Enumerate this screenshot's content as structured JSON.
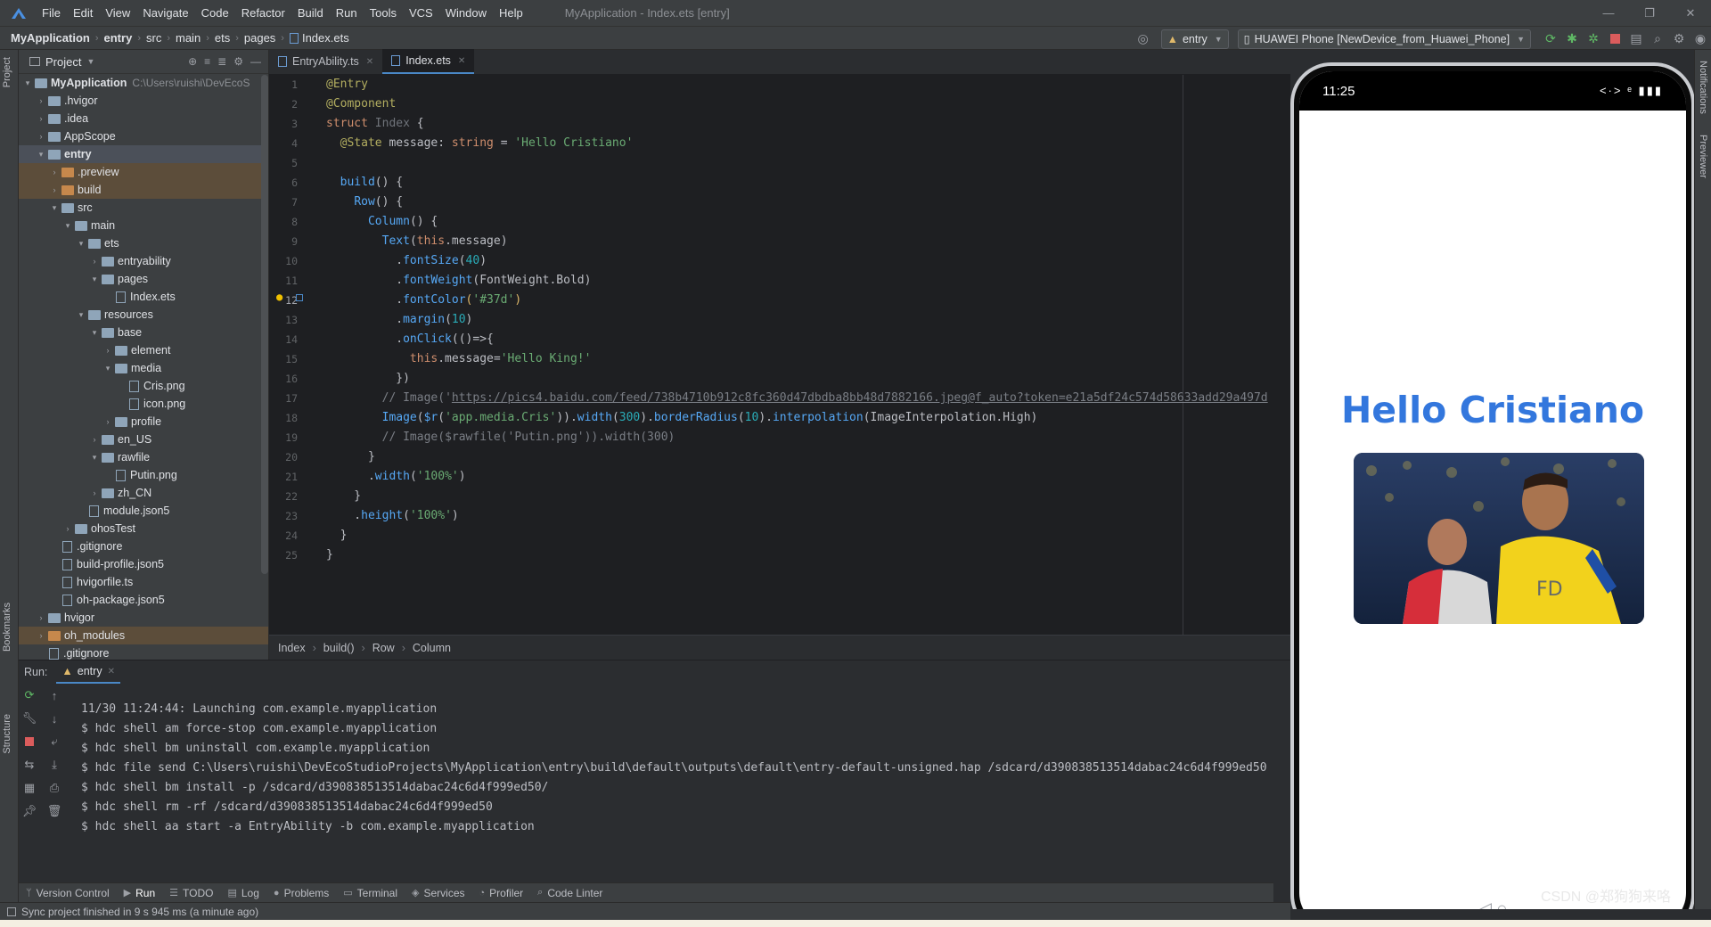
{
  "window": {
    "title": "MyApplication - Index.ets [entry]",
    "menu": [
      "File",
      "Edit",
      "View",
      "Navigate",
      "Code",
      "Refactor",
      "Build",
      "Run",
      "Tools",
      "VCS",
      "Window",
      "Help"
    ]
  },
  "breadcrumbs": [
    "MyApplication",
    "entry",
    "src",
    "main",
    "ets",
    "pages",
    "Index.ets"
  ],
  "run_config": {
    "module": "entry",
    "device": "HUAWEI Phone [NewDevice_from_Huawei_Phone]"
  },
  "project_panel": {
    "title": "Project",
    "tree": [
      {
        "label": "MyApplication",
        "path": "C:\\Users\\ruishi\\DevEcoS",
        "depth": 0,
        "type": "folder",
        "open": true,
        "bold": true
      },
      {
        "label": ".hvigor",
        "depth": 1,
        "type": "folder",
        "open": false
      },
      {
        "label": ".idea",
        "depth": 1,
        "type": "folder",
        "open": false
      },
      {
        "label": "AppScope",
        "depth": 1,
        "type": "folder",
        "open": false
      },
      {
        "label": "entry",
        "depth": 1,
        "type": "folder",
        "open": true,
        "bold": true,
        "highlight": "sel"
      },
      {
        "label": ".preview",
        "depth": 2,
        "type": "folder",
        "open": false,
        "color": "orange",
        "highlight": "hl"
      },
      {
        "label": "build",
        "depth": 2,
        "type": "folder",
        "open": false,
        "color": "orange",
        "highlight": "hl"
      },
      {
        "label": "src",
        "depth": 2,
        "type": "folder",
        "open": true
      },
      {
        "label": "main",
        "depth": 3,
        "type": "folder",
        "open": true
      },
      {
        "label": "ets",
        "depth": 4,
        "type": "folder",
        "open": true
      },
      {
        "label": "entryability",
        "depth": 5,
        "type": "folder",
        "open": false
      },
      {
        "label": "pages",
        "depth": 5,
        "type": "folder",
        "open": true
      },
      {
        "label": "Index.ets",
        "depth": 6,
        "type": "file"
      },
      {
        "label": "resources",
        "depth": 4,
        "type": "folder",
        "open": true
      },
      {
        "label": "base",
        "depth": 5,
        "type": "folder",
        "open": true
      },
      {
        "label": "element",
        "depth": 6,
        "type": "folder",
        "open": false
      },
      {
        "label": "media",
        "depth": 6,
        "type": "folder",
        "open": true
      },
      {
        "label": "Cris.png",
        "depth": 7,
        "type": "file"
      },
      {
        "label": "icon.png",
        "depth": 7,
        "type": "file"
      },
      {
        "label": "profile",
        "depth": 6,
        "type": "folder",
        "open": false
      },
      {
        "label": "en_US",
        "depth": 5,
        "type": "folder",
        "open": false
      },
      {
        "label": "rawfile",
        "depth": 5,
        "type": "folder",
        "open": true
      },
      {
        "label": "Putin.png",
        "depth": 6,
        "type": "file"
      },
      {
        "label": "zh_CN",
        "depth": 5,
        "type": "folder",
        "open": false
      },
      {
        "label": "module.json5",
        "depth": 4,
        "type": "file"
      },
      {
        "label": "ohosTest",
        "depth": 3,
        "type": "folder",
        "open": false
      },
      {
        "label": ".gitignore",
        "depth": 2,
        "type": "file"
      },
      {
        "label": "build-profile.json5",
        "depth": 2,
        "type": "file"
      },
      {
        "label": "hvigorfile.ts",
        "depth": 2,
        "type": "file"
      },
      {
        "label": "oh-package.json5",
        "depth": 2,
        "type": "file"
      },
      {
        "label": "hvigor",
        "depth": 1,
        "type": "folder",
        "open": false
      },
      {
        "label": "oh_modules",
        "depth": 1,
        "type": "folder",
        "open": false,
        "color": "orange",
        "highlight": "hl"
      },
      {
        "label": ".gitignore",
        "depth": 1,
        "type": "file"
      }
    ]
  },
  "editor": {
    "tabs": [
      {
        "label": "EntryAbility.ts",
        "active": false
      },
      {
        "label": "Index.ets",
        "active": true
      }
    ],
    "current_line": 12,
    "lines": [
      [
        {
          "c": "dec",
          "t": "@Entry"
        }
      ],
      [
        {
          "c": "dec",
          "t": "@Component"
        }
      ],
      [
        {
          "c": "kw",
          "t": "struct "
        },
        {
          "c": "cls",
          "t": "Index"
        },
        {
          "c": "",
          "t": " {"
        }
      ],
      [
        {
          "c": "",
          "t": "  "
        },
        {
          "c": "dec",
          "t": "@State"
        },
        {
          "c": "",
          "t": " message: "
        },
        {
          "c": "kw",
          "t": "string"
        },
        {
          "c": "",
          "t": " = "
        },
        {
          "c": "str",
          "t": "'Hello Cristiano'"
        }
      ],
      [
        {
          "c": "",
          "t": ""
        }
      ],
      [
        {
          "c": "",
          "t": "  "
        },
        {
          "c": "fn",
          "t": "build"
        },
        {
          "c": "",
          "t": "() {"
        }
      ],
      [
        {
          "c": "",
          "t": "    "
        },
        {
          "c": "fn",
          "t": "Row"
        },
        {
          "c": "",
          "t": "() {"
        }
      ],
      [
        {
          "c": "",
          "t": "      "
        },
        {
          "c": "fn",
          "t": "Column"
        },
        {
          "c": "",
          "t": "() {"
        }
      ],
      [
        {
          "c": "",
          "t": "        "
        },
        {
          "c": "fn",
          "t": "Text"
        },
        {
          "c": "",
          "t": "("
        },
        {
          "c": "kw",
          "t": "this"
        },
        {
          "c": "",
          "t": ".message)"
        }
      ],
      [
        {
          "c": "",
          "t": "          ."
        },
        {
          "c": "fn",
          "t": "fontSize"
        },
        {
          "c": "",
          "t": "("
        },
        {
          "c": "num",
          "t": "40"
        },
        {
          "c": "",
          "t": ")"
        }
      ],
      [
        {
          "c": "",
          "t": "          ."
        },
        {
          "c": "fn",
          "t": "fontWeight"
        },
        {
          "c": "",
          "t": "(FontWeight.Bold)"
        }
      ],
      [
        {
          "c": "",
          "t": "          ."
        },
        {
          "c": "fn",
          "t": "fontColor"
        },
        {
          "c": "yel",
          "t": "("
        },
        {
          "c": "str",
          "t": "'#37d'"
        },
        {
          "c": "yel",
          "t": ")"
        }
      ],
      [
        {
          "c": "",
          "t": "          ."
        },
        {
          "c": "fn",
          "t": "margin"
        },
        {
          "c": "",
          "t": "("
        },
        {
          "c": "num",
          "t": "10"
        },
        {
          "c": "",
          "t": ")"
        }
      ],
      [
        {
          "c": "",
          "t": "          ."
        },
        {
          "c": "fn",
          "t": "onClick"
        },
        {
          "c": "",
          "t": "(()=>{"
        }
      ],
      [
        {
          "c": "",
          "t": "            "
        },
        {
          "c": "kw",
          "t": "this"
        },
        {
          "c": "",
          "t": ".message="
        },
        {
          "c": "str",
          "t": "'Hello King!'"
        }
      ],
      [
        {
          "c": "",
          "t": "          })"
        }
      ],
      [
        {
          "c": "",
          "t": "        "
        },
        {
          "c": "cm",
          "t": "// Image('"
        },
        {
          "c": "lnk",
          "t": "https://pics4.baidu.com/feed/738b4710b912c8fc360d47dbdba8bb48d7882166.jpeg@f_auto?token=e21a5df24c574d58633add29a497d"
        }
      ],
      [
        {
          "c": "",
          "t": "        "
        },
        {
          "c": "fn",
          "t": "Image"
        },
        {
          "c": "",
          "t": "("
        },
        {
          "c": "fn",
          "t": "$r"
        },
        {
          "c": "",
          "t": "("
        },
        {
          "c": "str",
          "t": "'app.media.Cris'"
        },
        {
          "c": "",
          "t": "))."
        },
        {
          "c": "fn",
          "t": "width"
        },
        {
          "c": "",
          "t": "("
        },
        {
          "c": "num",
          "t": "300"
        },
        {
          "c": "",
          "t": ")."
        },
        {
          "c": "fn",
          "t": "borderRadius"
        },
        {
          "c": "",
          "t": "("
        },
        {
          "c": "num",
          "t": "10"
        },
        {
          "c": "",
          "t": ")."
        },
        {
          "c": "fn",
          "t": "interpolation"
        },
        {
          "c": "",
          "t": "(ImageInterpolation.High)"
        }
      ],
      [
        {
          "c": "",
          "t": "        "
        },
        {
          "c": "cm",
          "t": "// Image($rawfile('Putin.png')).width(300)"
        }
      ],
      [
        {
          "c": "",
          "t": "      }"
        }
      ],
      [
        {
          "c": "",
          "t": "      ."
        },
        {
          "c": "fn",
          "t": "width"
        },
        {
          "c": "",
          "t": "("
        },
        {
          "c": "str",
          "t": "'100%'"
        },
        {
          "c": "",
          "t": ")"
        }
      ],
      [
        {
          "c": "",
          "t": "    }"
        }
      ],
      [
        {
          "c": "",
          "t": "    ."
        },
        {
          "c": "fn",
          "t": "height"
        },
        {
          "c": "",
          "t": "("
        },
        {
          "c": "str",
          "t": "'100%'"
        },
        {
          "c": "",
          "t": ")"
        }
      ],
      [
        {
          "c": "",
          "t": "  }"
        }
      ],
      [
        {
          "c": "",
          "t": "}"
        }
      ]
    ],
    "breadcrumb": [
      "Index",
      "build()",
      "Row",
      "Column"
    ]
  },
  "run_panel": {
    "label": "Run:",
    "tab": "entry",
    "console": [
      "11/30 11:24:44: Launching com.example.myapplication",
      "$ hdc shell am force-stop com.example.myapplication",
      "$ hdc shell bm uninstall com.example.myapplication",
      "$ hdc file send C:\\Users\\ruishi\\DevEcoStudioProjects\\MyApplication\\entry\\build\\default\\outputs\\default\\entry-default-unsigned.hap /sdcard/d390838513514dabac24c6d4f999ed50",
      "$ hdc shell bm install -p /sdcard/d390838513514dabac24c6d4f999ed50/",
      "$ hdc shell rm -rf /sdcard/d390838513514dabac24c6d4f999ed50",
      "$ hdc shell aa start -a EntryAbility -b com.example.myapplication"
    ]
  },
  "bottom_tools": [
    "Version Control",
    "Run",
    "TODO",
    "Log",
    "Problems",
    "Terminal",
    "Services",
    "Profiler",
    "Code Linter"
  ],
  "status": "Sync project finished in 9 s 945 ms (a minute ago)",
  "side_labels": {
    "left_top": "Project",
    "left_mid": "Bookmarks",
    "left_bottom": "Structure",
    "right_top": "Notifications",
    "right_mid": "Previewer"
  },
  "phone": {
    "time": "11:25",
    "status_icons": "<·> ᵉ ▮▮▮",
    "message": "Hello Cristiano",
    "message_color": "#3377dd",
    "image_alt": "Cris.png"
  },
  "watermark": "CSDN @郑狗狗来咯"
}
